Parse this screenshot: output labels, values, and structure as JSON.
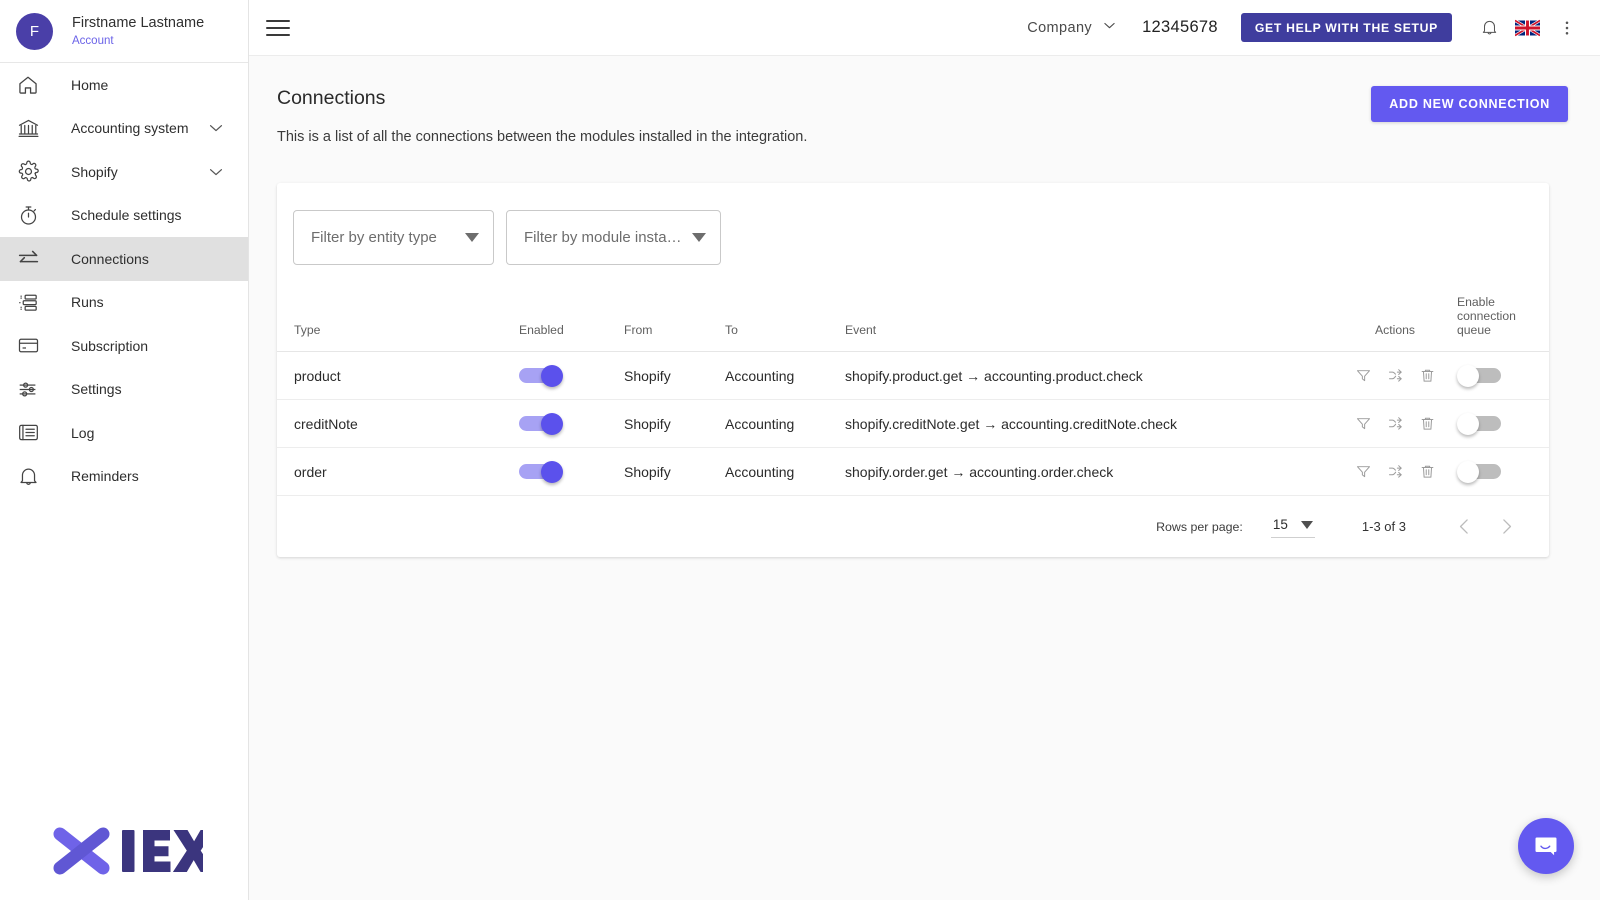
{
  "sidebar": {
    "user": {
      "initial": "F",
      "name": "Firstname Lastname",
      "account_link": "Account"
    },
    "items": [
      {
        "label": "Home",
        "icon": "home-icon",
        "expandable": false,
        "active": false
      },
      {
        "label": "Accounting system",
        "icon": "bank-icon",
        "expandable": true,
        "active": false
      },
      {
        "label": "Shopify",
        "icon": "gear-icon",
        "expandable": true,
        "active": false
      },
      {
        "label": "Schedule settings",
        "icon": "timer-icon",
        "expandable": false,
        "active": false
      },
      {
        "label": "Connections",
        "icon": "exchange-arrows-icon",
        "expandable": false,
        "active": true
      },
      {
        "label": "Runs",
        "icon": "list-runs-icon",
        "expandable": false,
        "active": false
      },
      {
        "label": "Subscription",
        "icon": "credit-card-icon",
        "expandable": false,
        "active": false
      },
      {
        "label": "Settings",
        "icon": "sliders-icon",
        "expandable": false,
        "active": false
      },
      {
        "label": "Log",
        "icon": "log-list-icon",
        "expandable": false,
        "active": false
      },
      {
        "label": "Reminders",
        "icon": "bell-icon",
        "expandable": false,
        "active": false
      }
    ],
    "logo_text": "IEX"
  },
  "topbar": {
    "company_label": "Company",
    "company_number": "12345678",
    "help_button": "GET HELP WITH THE SETUP",
    "language_flag": "uk-flag-icon"
  },
  "page": {
    "title": "Connections",
    "subtitle": "This is a list of all the connections between the modules installed in the integration.",
    "add_button": "ADD NEW CONNECTION"
  },
  "filters": [
    {
      "placeholder": "Filter by entity type",
      "value": ""
    },
    {
      "placeholder": "Filter by module insta…",
      "value": ""
    }
  ],
  "table": {
    "columns": [
      "Type",
      "Enabled",
      "From",
      "To",
      "Event",
      "Actions",
      "Enable connection queue"
    ],
    "rows": [
      {
        "type": "product",
        "enabled": true,
        "from": "Shopify",
        "to": "Accounting",
        "event": "shopify.product.get → accounting.product.check",
        "queue": false
      },
      {
        "type": "creditNote",
        "enabled": true,
        "from": "Shopify",
        "to": "Accounting",
        "event": "shopify.creditNote.get → accounting.creditNote.check",
        "queue": false
      },
      {
        "type": "order",
        "enabled": true,
        "from": "Shopify",
        "to": "Accounting",
        "event": "shopify.order.get → accounting.order.check",
        "queue": false
      }
    ],
    "row_actions": [
      "filter-icon",
      "shuffle-icon",
      "trash-icon"
    ]
  },
  "pagination": {
    "rows_per_page_label": "Rows per page:",
    "rows_per_page_value": "15",
    "range": "1-3 of 3"
  },
  "colors": {
    "accent": "#6359f0",
    "accent_dark": "#3f3d9e",
    "toggle_on_thumb": "#5b51ec",
    "toggle_on_track": "#a7a2f4",
    "sidebar_active_bg": "#e0e0e0",
    "page_bg": "#fafafa"
  }
}
